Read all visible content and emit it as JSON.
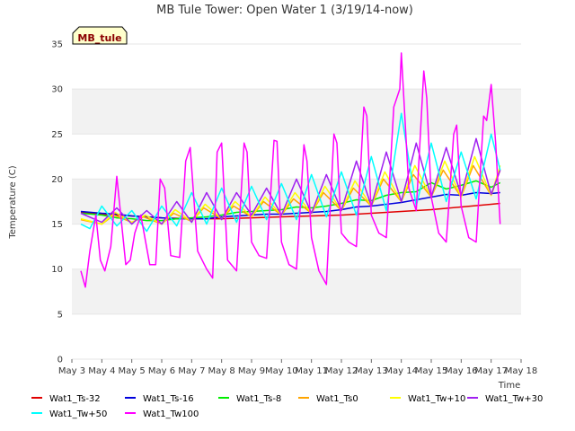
{
  "chart_data": {
    "type": "line",
    "title": "MB Tule Tower: Open Water 1 (3/19/14-now)",
    "xlabel": "Time",
    "ylabel": "Temperature (C)",
    "badge": "MB_tule",
    "ylim": [
      0,
      35
    ],
    "yticks": [
      0,
      5,
      10,
      15,
      20,
      25,
      30,
      35
    ],
    "xlim": [
      3,
      18
    ],
    "xticks": [
      {
        "v": 3,
        "label": "May 3"
      },
      {
        "v": 4,
        "label": "May 4"
      },
      {
        "v": 5,
        "label": "May 5"
      },
      {
        "v": 6,
        "label": "May 6"
      },
      {
        "v": 7,
        "label": "May 7"
      },
      {
        "v": 8,
        "label": "May 8"
      },
      {
        "v": 9,
        "label": "May 9"
      },
      {
        "v": 10,
        "label": "May 10"
      },
      {
        "v": 11,
        "label": "May 11"
      },
      {
        "v": 12,
        "label": "May 12"
      },
      {
        "v": 13,
        "label": "May 13"
      },
      {
        "v": 14,
        "label": "May 14"
      },
      {
        "v": 15,
        "label": "May 15"
      },
      {
        "v": 16,
        "label": "May 16"
      },
      {
        "v": 17,
        "label": "May 17"
      },
      {
        "v": 18,
        "label": "May 18"
      }
    ],
    "grid": "alternating horizontal bands",
    "legend_position": "bottom",
    "series": [
      {
        "name": "Wat1_Ts-32",
        "color": "#e00000",
        "x": [
          3.3,
          4,
          5,
          6,
          7,
          8,
          9,
          10,
          11,
          12,
          13,
          14,
          15,
          16,
          17,
          17.3
        ],
        "y": [
          16.3,
          16.1,
          15.9,
          15.7,
          15.6,
          15.6,
          15.7,
          15.8,
          15.9,
          16.0,
          16.2,
          16.4,
          16.6,
          16.9,
          17.2,
          17.3
        ]
      },
      {
        "name": "Wat1_Ts-16",
        "color": "#0000dd",
        "x": [
          3.3,
          4,
          4.5,
          5,
          5.5,
          6,
          6.5,
          7,
          7.5,
          8,
          8.5,
          9,
          9.5,
          10,
          10.5,
          11,
          11.5,
          12,
          12.5,
          13,
          13.5,
          14,
          14.5,
          15,
          15.5,
          16,
          16.5,
          17,
          17.3
        ],
        "y": [
          16.4,
          16.2,
          16.1,
          15.9,
          15.8,
          15.7,
          15.6,
          15.6,
          15.6,
          15.8,
          15.9,
          16.0,
          16.1,
          16.1,
          16.2,
          16.3,
          16.4,
          16.6,
          16.9,
          17.0,
          17.2,
          17.4,
          17.7,
          18.0,
          18.3,
          18.2,
          18.5,
          18.4,
          18.5
        ]
      },
      {
        "name": "Wat1_Ts-8",
        "color": "#00ee00",
        "x": [
          3.3,
          4,
          4.5,
          5,
          5.5,
          6,
          6.5,
          7,
          7.5,
          8,
          8.5,
          9,
          9.5,
          10,
          10.5,
          11,
          11.5,
          12,
          12.5,
          13,
          13.5,
          14,
          14.5,
          15,
          15.5,
          16,
          16.5,
          17,
          17.3
        ],
        "y": [
          16.2,
          16.0,
          15.7,
          15.6,
          15.4,
          15.4,
          15.6,
          15.7,
          15.8,
          16.0,
          16.3,
          16.4,
          16.5,
          16.6,
          16.9,
          16.8,
          17.0,
          17.3,
          17.7,
          17.6,
          18.2,
          18.5,
          18.6,
          19.6,
          18.9,
          19.3,
          19.8,
          19.1,
          19.6
        ]
      },
      {
        "name": "Wat1_Ts0",
        "color": "#ffa500",
        "x": [
          3.3,
          4,
          4.4,
          5,
          5.4,
          6,
          6.4,
          7,
          7.4,
          8,
          8.4,
          9,
          9.4,
          10,
          10.4,
          11,
          11.4,
          12,
          12.4,
          13,
          13.4,
          14,
          14.4,
          15,
          15.4,
          16,
          16.4,
          17,
          17.3
        ],
        "y": [
          15.5,
          15.0,
          16.0,
          15.2,
          15.8,
          15.0,
          16.2,
          15.3,
          16.8,
          15.6,
          17.0,
          15.8,
          17.5,
          16.0,
          17.8,
          16.2,
          18.5,
          16.5,
          19.0,
          17.0,
          20.0,
          17.5,
          20.5,
          18.0,
          21.0,
          18.0,
          21.5,
          18.2,
          21.0
        ]
      },
      {
        "name": "Wat1_Tw+10",
        "color": "#ffff00",
        "x": [
          3.3,
          4,
          4.45,
          5,
          5.45,
          6,
          6.45,
          7,
          7.45,
          8,
          8.45,
          9,
          9.45,
          10,
          10.45,
          11,
          11.45,
          12,
          12.45,
          13,
          13.45,
          14,
          14.45,
          15,
          15.45,
          16,
          16.45,
          17,
          17.3
        ],
        "y": [
          15.6,
          15.0,
          16.3,
          15.2,
          16.0,
          15.0,
          16.6,
          15.3,
          17.2,
          15.6,
          17.5,
          15.8,
          18.0,
          16.0,
          18.5,
          16.2,
          19.2,
          16.5,
          19.8,
          17.0,
          20.8,
          17.5,
          21.5,
          18.0,
          22.0,
          18.0,
          22.5,
          18.2,
          21.5
        ]
      },
      {
        "name": "Wat1_Tw+30",
        "color": "#a020f0",
        "x": [
          3.3,
          4,
          4.5,
          5,
          5.5,
          6,
          6.5,
          7,
          7.5,
          8,
          8.5,
          9,
          9.5,
          10,
          10.5,
          11,
          11.5,
          12,
          12.5,
          13,
          13.5,
          14,
          14.5,
          15,
          15.5,
          16,
          16.5,
          17,
          17.3
        ],
        "y": [
          16.2,
          15.2,
          16.8,
          15.0,
          16.5,
          15.0,
          17.5,
          15.2,
          18.5,
          15.5,
          18.5,
          16.0,
          19.0,
          16.0,
          20.0,
          16.2,
          20.5,
          16.5,
          22.0,
          17.0,
          23.0,
          17.5,
          24.0,
          18.0,
          23.5,
          18.2,
          24.5,
          18.3,
          21.0
        ]
      },
      {
        "name": "Wat1_Tw+50",
        "color": "#00ffff",
        "x": [
          3.3,
          3.6,
          4,
          4.5,
          5,
          5.5,
          6,
          6.5,
          7,
          7.5,
          8,
          8.5,
          9,
          9.5,
          10,
          10.5,
          11,
          11.5,
          12,
          12.5,
          13,
          13.5,
          14,
          14.5,
          15,
          15.5,
          16,
          16.5,
          17,
          17.3
        ],
        "y": [
          15.0,
          14.5,
          17.0,
          14.8,
          16.5,
          14.2,
          17.0,
          14.8,
          18.5,
          15.0,
          19.0,
          15.2,
          19.2,
          15.5,
          19.5,
          15.5,
          20.5,
          15.8,
          20.8,
          16.0,
          22.5,
          16.5,
          27.3,
          17.0,
          24.0,
          17.5,
          23.0,
          17.8,
          25.0,
          21.0
        ]
      },
      {
        "name": "Wat1_Tw100",
        "color": "#ff00ff",
        "x": [
          3.3,
          3.45,
          3.6,
          3.8,
          3.95,
          4.1,
          4.3,
          4.5,
          4.8,
          4.95,
          5.1,
          5.3,
          5.6,
          5.8,
          5.95,
          6.1,
          6.3,
          6.6,
          6.8,
          6.95,
          7.2,
          7.5,
          7.7,
          7.85,
          8.0,
          8.2,
          8.5,
          8.75,
          8.85,
          9.0,
          9.25,
          9.5,
          9.75,
          9.85,
          10.0,
          10.25,
          10.5,
          10.75,
          10.85,
          11.0,
          11.25,
          11.5,
          11.75,
          11.85,
          12.0,
          12.25,
          12.5,
          12.75,
          12.85,
          13.0,
          13.25,
          13.5,
          13.75,
          13.95,
          14.0,
          14.25,
          14.5,
          14.75,
          14.85,
          15.0,
          15.25,
          15.5,
          15.75,
          15.85,
          16.0,
          16.25,
          16.5,
          16.75,
          16.85,
          17.0,
          17.15,
          17.25,
          17.3
        ],
        "y": [
          9.8,
          8.0,
          12.0,
          16.0,
          11.0,
          9.8,
          12.5,
          20.3,
          10.5,
          11.0,
          14.0,
          16.0,
          10.5,
          10.5,
          20.0,
          19.0,
          11.5,
          11.3,
          22.0,
          23.5,
          12.0,
          10.0,
          9.0,
          23.0,
          24.0,
          11.0,
          9.8,
          24.0,
          23.0,
          13.0,
          11.5,
          11.2,
          24.3,
          24.2,
          13.0,
          10.5,
          10.0,
          23.8,
          22.0,
          13.5,
          9.8,
          8.3,
          25.0,
          24.0,
          14.0,
          13.0,
          12.5,
          28.0,
          27.0,
          16.0,
          14.0,
          13.5,
          28.0,
          30.0,
          34.0,
          19.0,
          16.5,
          32.0,
          29.0,
          18.0,
          14.0,
          13.0,
          25.0,
          26.0,
          17.0,
          13.5,
          13.0,
          27.0,
          26.5,
          30.5,
          24.0,
          18.0,
          15.0
        ]
      }
    ]
  }
}
